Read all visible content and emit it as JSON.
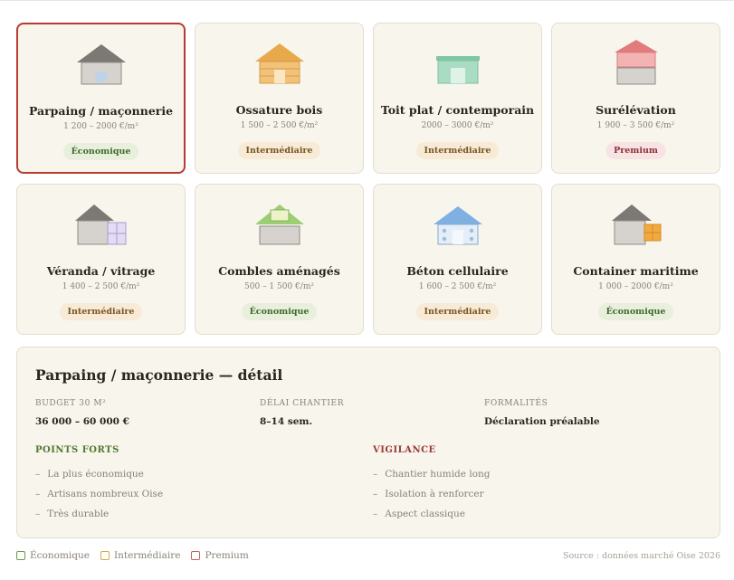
{
  "cards": [
    {
      "title": "Parpaing / maçonnerie",
      "price": "1 200 – 2000 €/m²",
      "badge": "Économique",
      "tier": "eco",
      "icon": "parpaing-house-icon",
      "selected": true
    },
    {
      "title": "Ossature bois",
      "price": "1 500 – 2 500 €/m²",
      "badge": "Intermédiaire",
      "tier": "mid",
      "icon": "wood-frame-house-icon",
      "selected": false
    },
    {
      "title": "Toit plat / contemporain",
      "price": "2000 – 3000 €/m²",
      "badge": "Intermédiaire",
      "tier": "mid",
      "icon": "flat-roof-house-icon",
      "selected": false
    },
    {
      "title": "Surélévation",
      "price": "1 900 – 3 500 €/m²",
      "badge": "Premium",
      "tier": "pre",
      "icon": "raised-floor-house-icon",
      "selected": false
    },
    {
      "title": "Véranda / vitrage",
      "price": "1 400 – 2 500 €/m²",
      "badge": "Intermédiaire",
      "tier": "mid",
      "icon": "veranda-house-icon",
      "selected": false
    },
    {
      "title": "Combles aménagés",
      "price": "500 – 1 500 €/m²",
      "badge": "Économique",
      "tier": "eco",
      "icon": "attic-house-icon",
      "selected": false
    },
    {
      "title": "Béton cellulaire",
      "price": "1 600 – 2 500 €/m²",
      "badge": "Intermédiaire",
      "tier": "mid",
      "icon": "aerated-concrete-house-icon",
      "selected": false
    },
    {
      "title": "Container maritime",
      "price": "1 000 – 2000 €/m²",
      "badge": "Économique",
      "tier": "eco",
      "icon": "container-house-icon",
      "selected": false
    }
  ],
  "detail": {
    "title": "Parpaing / maçonnerie — détail",
    "budget_label": "BUDGET 30 M²",
    "budget_value": "36 000 – 60 000 €",
    "delay_label": "DÉLAI CHANTIER",
    "delay_value": "8–14 sem.",
    "formalities_label": "FORMALITÉS",
    "formalities_value": "Déclaration préalable",
    "strengths_label": "POINTS FORTS",
    "strengths": [
      "La plus économique",
      "Artisans nombreux Oise",
      "Très durable"
    ],
    "vigilance_label": "VIGILANCE",
    "vigilance": [
      "Chantier humide long",
      "Isolation à renforcer",
      "Aspect classique"
    ]
  },
  "legend": {
    "eco": "Économique",
    "mid": "Intermédiaire",
    "pre": "Premium"
  },
  "source": "Source : données marché Oise 2026",
  "colors": {
    "eco": "#3f6a2a",
    "mid": "#7a5520",
    "premium": "#8f2f35",
    "selected_border": "#b83a32"
  }
}
